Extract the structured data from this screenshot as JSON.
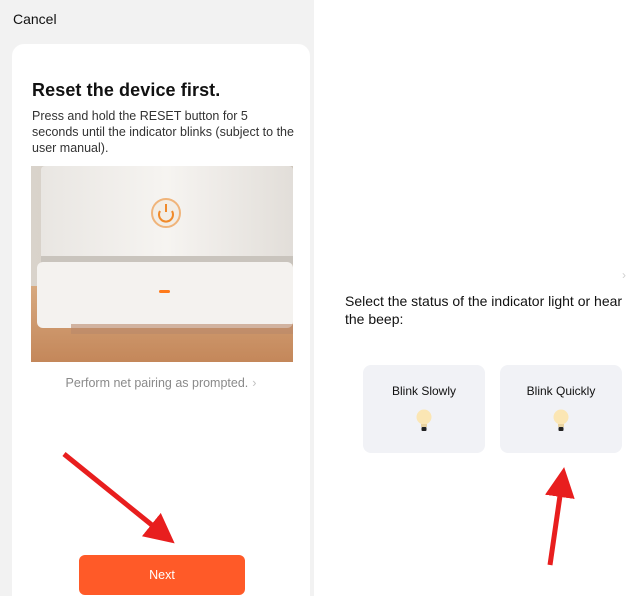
{
  "left_screen": {
    "cancel_label": "Cancel",
    "title": "Reset the device first.",
    "description": "Press and hold the RESET button for 5 seconds until the indicator blinks (subject to the user manual).",
    "pairing_link": "Perform net pairing as prompted.",
    "pairing_chevron": "›",
    "next_label": "Next",
    "accent_color": "#ff5a28"
  },
  "right_screen": {
    "chevron": "›",
    "prompt": "Select the status of the indicator light or hear the beep:",
    "options": [
      {
        "label": "Blink Slowly",
        "icon": "bulb-icon"
      },
      {
        "label": "Blink Quickly",
        "icon": "bulb-icon"
      }
    ]
  },
  "annotations": {
    "arrow_color": "#e81e1e",
    "arrows": [
      "pointing to Next button",
      "pointing to Blink Quickly option"
    ]
  }
}
